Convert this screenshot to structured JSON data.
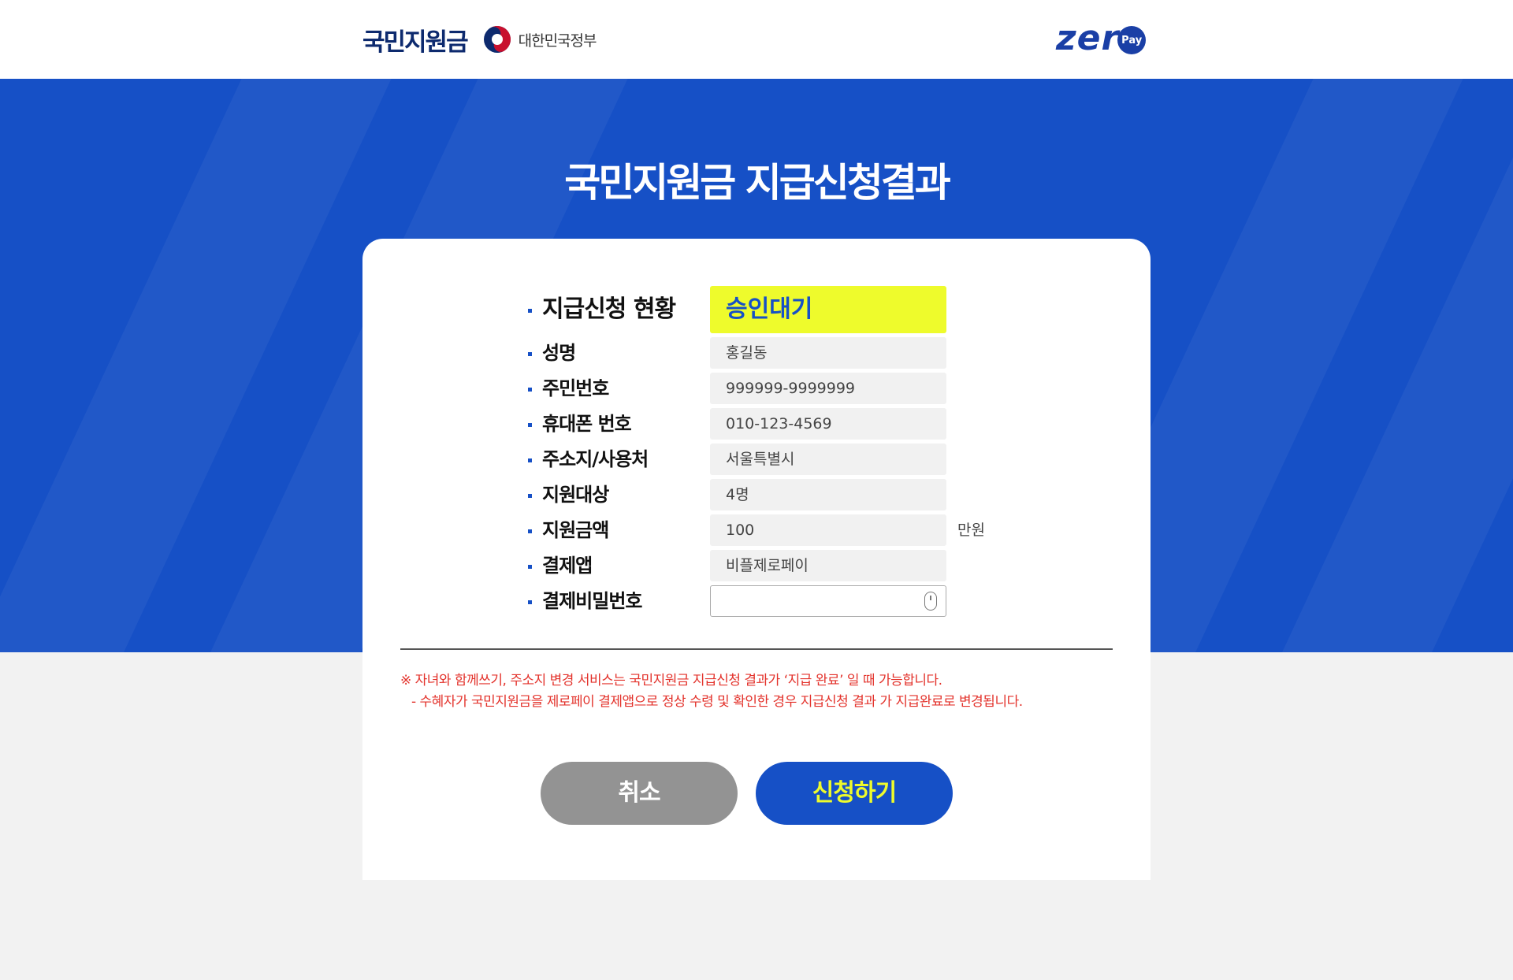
{
  "header": {
    "brand": "국민지원금",
    "government": "대한민국정부",
    "zeropay_text": "zer",
    "zeropay_pay": "Pay"
  },
  "hero": {
    "title": "국민지원금 지급신청결과"
  },
  "form": {
    "status": {
      "label": "지급신청 현황",
      "value": "승인대기"
    },
    "name": {
      "label": "성명",
      "value": "홍길동"
    },
    "resident_no": {
      "label": "주민번호",
      "value": "999999-9999999"
    },
    "phone": {
      "label": "휴대폰 번호",
      "value": "010-123-4569"
    },
    "address": {
      "label": "주소지/사용처",
      "value": "서울특별시"
    },
    "target": {
      "label": "지원대상",
      "value": "4명"
    },
    "amount": {
      "label": "지원금액",
      "value": "100",
      "unit": "만원"
    },
    "app": {
      "label": "결제앱",
      "value": "비플제로페이"
    },
    "password": {
      "label": "결제비밀번호",
      "value": ""
    }
  },
  "notice": {
    "line1": "※ 자녀와 함께쓰기, 주소지 변경 서비스는 국민지원금 지급신청 결과가 ‘지급 완료’ 일 때 가능합니다.",
    "line2": "- 수혜자가 국민지원금을 제로페이 결제앱으로 정상 수령 및 확인한 경우 지급신청 결과 가 지급완료로 변경됩니다."
  },
  "buttons": {
    "cancel": "취소",
    "apply": "신청하기"
  },
  "colors": {
    "primary": "#1650c6",
    "highlight": "#eefb2c",
    "notice": "#e3322b",
    "cancel": "#939393"
  },
  "icons": {
    "emblem": "taegeuk-emblem-icon",
    "password_field": "mouse-icon"
  }
}
